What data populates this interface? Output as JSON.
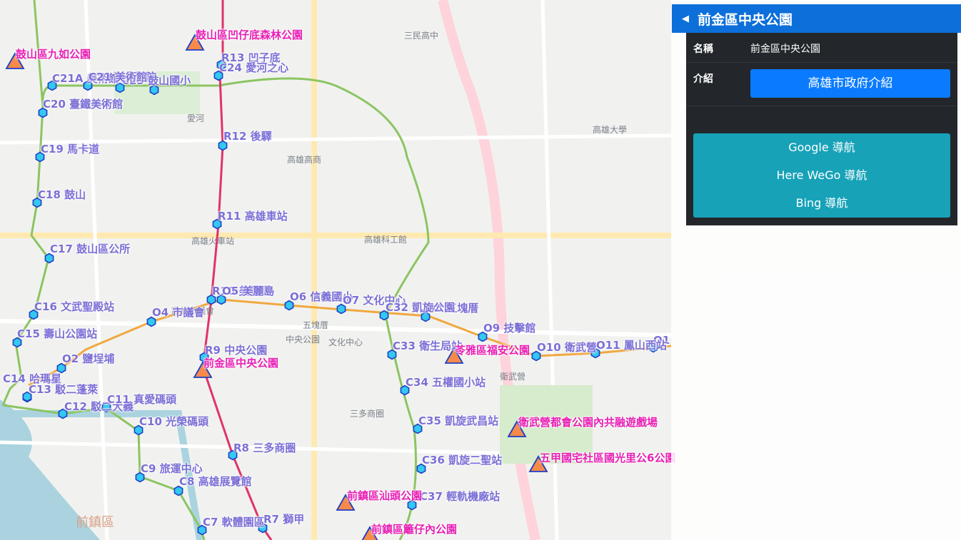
{
  "map": {
    "colors": {
      "red_line": "#e0336a",
      "orange_line": "#f0a840",
      "circular_line": "#8cc463",
      "station_fill": "#33c8f0",
      "station_stroke": "#1d3fc7",
      "park_fill": "#f58a4a",
      "park_stroke": "#1d3fc7",
      "station_label": "#7b6fd6",
      "park_label": "#e81fb4"
    },
    "district_labels": [
      "前鎮區"
    ],
    "stations": [
      "R13 凹子底",
      "R12 後驛",
      "R11 高雄車站",
      "R10 美麗島",
      "R9 中央公園",
      "R8 三多商圈",
      "R7 獅甲",
      "C24 愛河之心",
      "C22 聯合醫院",
      "C23 鼓山國小",
      "C21A 美術館",
      "C21 美術館",
      "C20 臺鐵美術館",
      "C19 馬卡道",
      "C18 鼓山",
      "C17 鼓山區公所",
      "C16 文武聖殿站",
      "C15 壽山公園站",
      "C14 哈瑪星",
      "C13 駁二蓬萊",
      "C12 駁二大義",
      "C11 真愛碼頭",
      "C10 光榮碼頭",
      "C9 旅運中心",
      "C8 高雄展覽館",
      "C7 軟體園區",
      "O1",
      "O2 鹽埕埔",
      "O4 市議會",
      "O5 美麗島",
      "O6 信義國小",
      "O7 文化中心",
      "O8 五塊厝",
      "O9 技擊館",
      "O10 衛武營",
      "O11 鳳山西站",
      "C32 凱旋公園",
      "C33 衛生局站",
      "C34 五權國小站",
      "C35 凱旋武昌站",
      "C36 凱旋二聖站",
      "C37 輕軌機廠站"
    ],
    "parks": [
      "鼓山區凹仔底森林公園",
      "鼓山區九如公園",
      "前金區中央公園",
      "苓雅區福安公園",
      "衛武營都會公園內共融遊戲場",
      "五甲國宅社區國光里公6公園",
      "前鎮區汕頭公園",
      "前鎮區籬仔內公園"
    ],
    "basemap_labels": [
      "高雄市議會",
      "三民高中",
      "高雄高商",
      "愛河",
      "高雄火車站",
      "高雄科工館",
      "文化中心",
      "中央公園",
      "衛武營",
      "三多商圈",
      "五塊厝",
      "高雄大學"
    ]
  },
  "panel": {
    "title": "前金區中央公園",
    "back_icon": "chevron-left-icon",
    "fields": [
      {
        "key": "名稱",
        "value": "前金區中央公園"
      },
      {
        "key": "介紹",
        "button": "高雄市政府介紹"
      }
    ],
    "nav_buttons": [
      "Google 導航",
      "Here WeGo 導航",
      "Bing 導航"
    ]
  }
}
